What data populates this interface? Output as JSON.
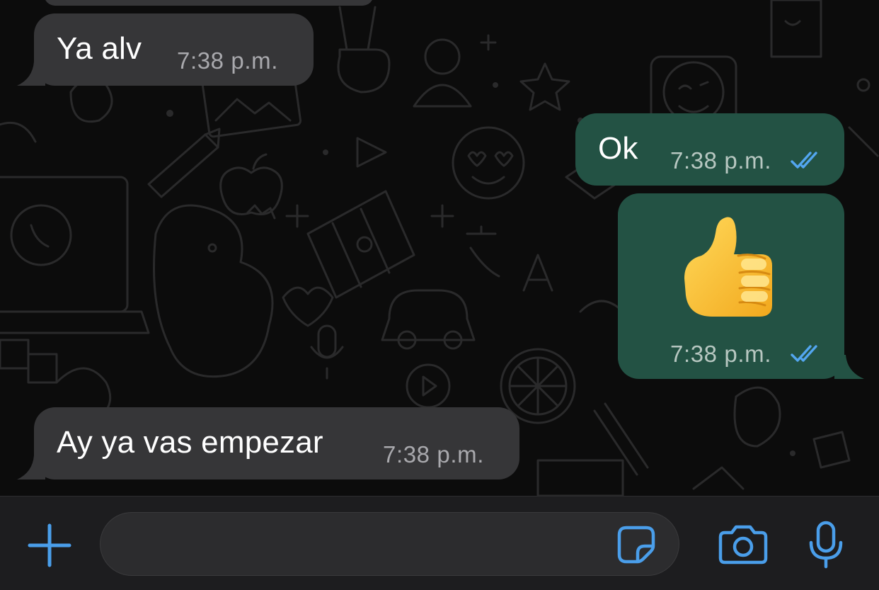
{
  "conversation": {
    "messages": [
      {
        "direction": "incoming",
        "text": "Ya alv",
        "time": "7:38 p.m."
      },
      {
        "direction": "outgoing",
        "text": "Ok",
        "time": "7:38 p.m.",
        "status": "read"
      },
      {
        "direction": "outgoing",
        "text": "👍",
        "time": "7:38 p.m.",
        "status": "read",
        "kind": "emoji"
      },
      {
        "direction": "incoming",
        "text": "Ay ya vas empezar",
        "time": "7:38 p.m."
      }
    ]
  },
  "composer": {
    "input_value": "",
    "icons": [
      "plus-icon",
      "sticker-icon",
      "camera-icon",
      "microphone-icon"
    ]
  },
  "colors": {
    "background": "#0c0c0c",
    "incoming_bubble": "#363638",
    "outgoing_bubble": "#235244",
    "accent_blue": "#4a9eea",
    "read_ticks": "#53a6f0",
    "doodle": "#2a2a2a"
  }
}
